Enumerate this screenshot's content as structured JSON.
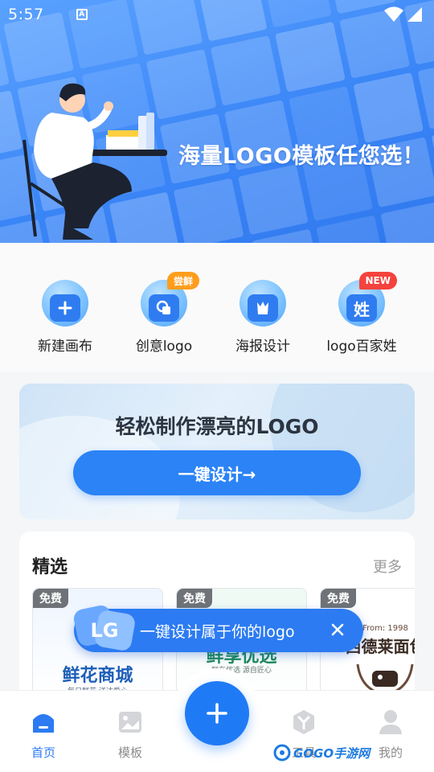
{
  "status_bar": {
    "time": "5:57",
    "notification_icon": "a-box-icon",
    "icons": [
      "wifi-icon",
      "signal-icon"
    ]
  },
  "hero": {
    "slogan": "海量LOGO模板任您选！",
    "accent": "#3b86f7"
  },
  "quick_actions": [
    {
      "label": "新建画布",
      "icon": "new-canvas-icon",
      "badge": ""
    },
    {
      "label": "创意logo",
      "icon": "creative-logo-icon",
      "badge": "尝鲜"
    },
    {
      "label": "海报设计",
      "icon": "poster-design-icon",
      "badge": ""
    },
    {
      "label": "logo百家姓",
      "icon": "surname-logo-icon",
      "glyph": "姓",
      "badge": "NEW"
    }
  ],
  "promo": {
    "title": "轻松制作漂亮的LOGO",
    "button": "一键设计→"
  },
  "featured": {
    "title": "精选",
    "more": "更多",
    "cards": [
      {
        "tag": "免费",
        "name": "鲜花商城",
        "sub": "每日鲜花 送达爱心"
      },
      {
        "tag": "免费",
        "name": "鲜享优选",
        "sub": "鲜在优选 源自匠心"
      },
      {
        "tag": "免费",
        "name": "西德莱面包",
        "sub": "From: 1998"
      }
    ]
  },
  "hint": {
    "logo": "LG",
    "text": "一键设计属于你的logo"
  },
  "bottom_nav": {
    "items": [
      {
        "label": "首页",
        "icon": "home-icon",
        "active": true
      },
      {
        "label": "模板",
        "icon": "template-icon",
        "active": false
      },
      {
        "label": "工具",
        "icon": "tools-icon",
        "active": false
      },
      {
        "label": "我的",
        "icon": "profile-icon",
        "active": false
      }
    ],
    "fab_icon": "plus-icon",
    "active_color": "#2c7bf2"
  },
  "watermark": {
    "text": "GOGO手游网"
  }
}
